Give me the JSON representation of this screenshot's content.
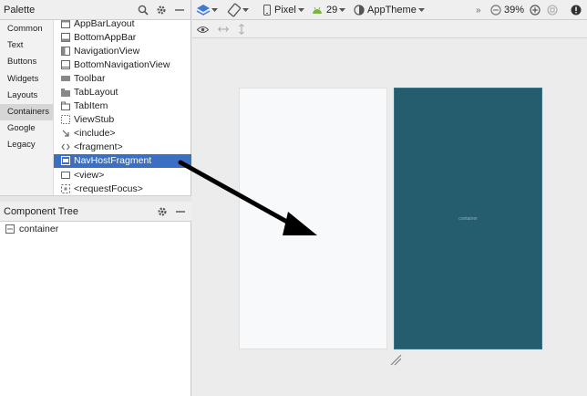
{
  "palette": {
    "title": "Palette",
    "categories": [
      "Common",
      "Text",
      "Buttons",
      "Widgets",
      "Layouts",
      "Containers",
      "Google",
      "Legacy"
    ],
    "selected_category": "Containers",
    "items": [
      {
        "label": "AppBarLayout",
        "icon": "appbar-icon"
      },
      {
        "label": "BottomAppBar",
        "icon": "bottomappbar-icon"
      },
      {
        "label": "NavigationView",
        "icon": "navigationview-icon"
      },
      {
        "label": "BottomNavigationView",
        "icon": "bottomnav-icon"
      },
      {
        "label": "Toolbar",
        "icon": "toolbar-icon"
      },
      {
        "label": "TabLayout",
        "icon": "tablayout-icon"
      },
      {
        "label": "TabItem",
        "icon": "tabitem-icon"
      },
      {
        "label": "ViewStub",
        "icon": "viewstub-icon"
      },
      {
        "label": "<include>",
        "icon": "include-arrow-icon"
      },
      {
        "label": "<fragment>",
        "icon": "code-brackets-icon"
      },
      {
        "label": "NavHostFragment",
        "icon": "navhost-icon"
      },
      {
        "label": "<view>",
        "icon": "view-icon"
      },
      {
        "label": "<requestFocus>",
        "icon": "requestfocus-icon"
      }
    ],
    "selected_item": "NavHostFragment"
  },
  "component_tree": {
    "title": "Component Tree",
    "nodes": [
      {
        "label": "container",
        "icon": "layout-icon"
      }
    ]
  },
  "toolbar": {
    "device": "Pixel",
    "api_level": "29",
    "theme": "AppTheme",
    "zoom": "39%",
    "overflow": "»"
  },
  "canvas": {
    "blueprint_label": "container"
  },
  "colors": {
    "selection": "#3a6fc4",
    "blueprint": "#255c6e",
    "android_green": "#7cb342",
    "layers_blue": "#3d78d8"
  }
}
